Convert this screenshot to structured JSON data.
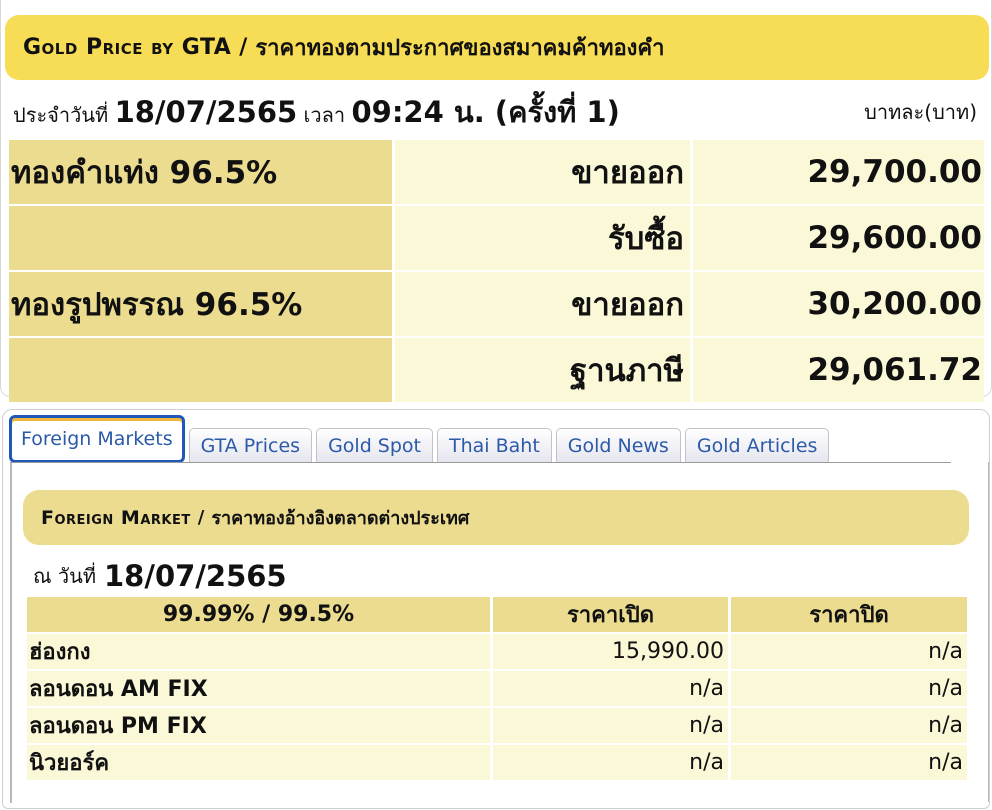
{
  "header": {
    "title_en": "Gold Price by GTA",
    "separator": "/",
    "title_th": "ราคาทองตามประกาศของสมาคมค้าทองคำ"
  },
  "announcement": {
    "date_label": "ประจำวันที่",
    "date": "18/07/2565",
    "time_label": "เวลา",
    "time": "09:24 น. (ครั้งที่ 1)",
    "unit": "บาทละ(บาท)"
  },
  "prices": [
    {
      "name": "ทองคำแท่ง 96.5%",
      "type": "ขายออก",
      "value": "29,700.00"
    },
    {
      "name": "",
      "type": "รับซื้อ",
      "value": "29,600.00"
    },
    {
      "name": "ทองรูปพรรณ 96.5%",
      "type": "ขายออก",
      "value": "30,200.00"
    },
    {
      "name": "",
      "type": "ฐานภาษี",
      "value": "29,061.72"
    }
  ],
  "tabs": [
    {
      "label": "Foreign Markets",
      "active": true
    },
    {
      "label": "GTA Prices",
      "active": false
    },
    {
      "label": "Gold Spot",
      "active": false
    },
    {
      "label": "Thai Baht",
      "active": false
    },
    {
      "label": "Gold News",
      "active": false
    },
    {
      "label": "Gold Articles",
      "active": false
    }
  ],
  "foreign_market": {
    "title_en": "Foreign Market",
    "separator": "/",
    "title_th": "ราคาทองอ้างอิงตลาดต่างประเทศ",
    "date_label": "ณ วันที่",
    "date": "18/07/2565",
    "columns": [
      "99.99% / 99.5%",
      "ราคาเปิด",
      "ราคาปิด"
    ],
    "rows": [
      {
        "market": "ฮ่องกง",
        "open": "15,990.00",
        "close": "n/a"
      },
      {
        "market": "ลอนดอน AM FIX",
        "open": "n/a",
        "close": "n/a"
      },
      {
        "market": "ลอนดอน PM FIX",
        "open": "n/a",
        "close": "n/a"
      },
      {
        "market": "นิวยอร์ค",
        "open": "n/a",
        "close": "n/a"
      }
    ]
  },
  "colors": {
    "banner": "#f7dc55",
    "label_cell": "#ebdc90",
    "value_cell": "#fbf8d8",
    "tab_text": "#2a5aa8",
    "active_tab_border": "#1f58b8"
  }
}
